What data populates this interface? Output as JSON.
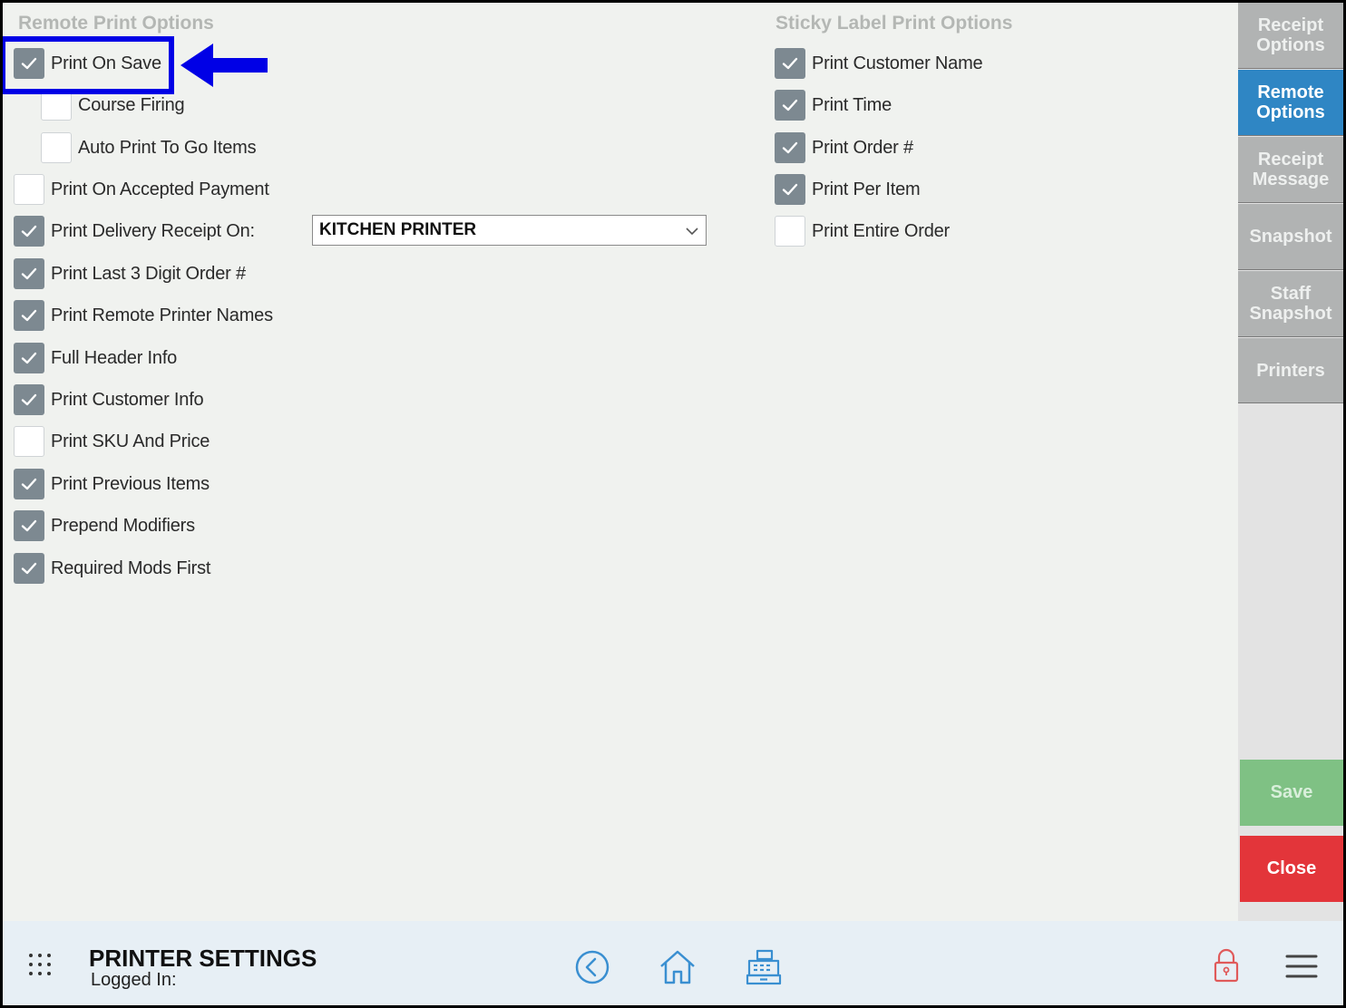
{
  "remote_section": {
    "title": "Remote Print Options",
    "options": [
      {
        "label": "Print On Save",
        "checked": true
      },
      {
        "label": "Course Firing",
        "checked": false
      },
      {
        "label": "Auto Print To Go Items",
        "checked": false
      },
      {
        "label": "Print On Accepted Payment",
        "checked": false
      },
      {
        "label": "Print Delivery Receipt On:",
        "checked": true
      },
      {
        "label": "Print Last 3 Digit Order #",
        "checked": true
      },
      {
        "label": "Print Remote Printer Names",
        "checked": true
      },
      {
        "label": "Full Header Info",
        "checked": true
      },
      {
        "label": "Print Customer Info",
        "checked": true
      },
      {
        "label": "Print SKU And Price",
        "checked": false
      },
      {
        "label": "Print Previous Items",
        "checked": true
      },
      {
        "label": "Prepend Modifiers",
        "checked": true
      },
      {
        "label": "Required Mods First",
        "checked": true
      }
    ],
    "delivery_printer": "KITCHEN PRINTER"
  },
  "sticky_section": {
    "title": "Sticky Label Print Options",
    "options": [
      {
        "label": "Print Customer Name",
        "checked": true
      },
      {
        "label": "Print Time",
        "checked": true
      },
      {
        "label": "Print Order #",
        "checked": true
      },
      {
        "label": "Print Per Item",
        "checked": true
      },
      {
        "label": "Print Entire Order",
        "checked": false
      }
    ]
  },
  "sidebar": {
    "tabs": [
      {
        "label": "Receipt\nOptions",
        "active": false
      },
      {
        "label": "Remote\nOptions",
        "active": true
      },
      {
        "label": "Receipt\nMessage",
        "active": false
      },
      {
        "label": "Snapshot",
        "active": false
      },
      {
        "label": "Staff\nSnapshot",
        "active": false
      },
      {
        "label": "Printers",
        "active": false
      }
    ],
    "save_label": "Save",
    "close_label": "Close"
  },
  "footer": {
    "title": "PRINTER SETTINGS",
    "logged_in": "Logged In:"
  },
  "colors": {
    "checkbox_on": "#7d8991",
    "tab_active": "#2f86c4",
    "save": "#7fc184",
    "close": "#e3353a",
    "highlight": "#0000e6",
    "icon_blue": "#3a8fd1"
  }
}
